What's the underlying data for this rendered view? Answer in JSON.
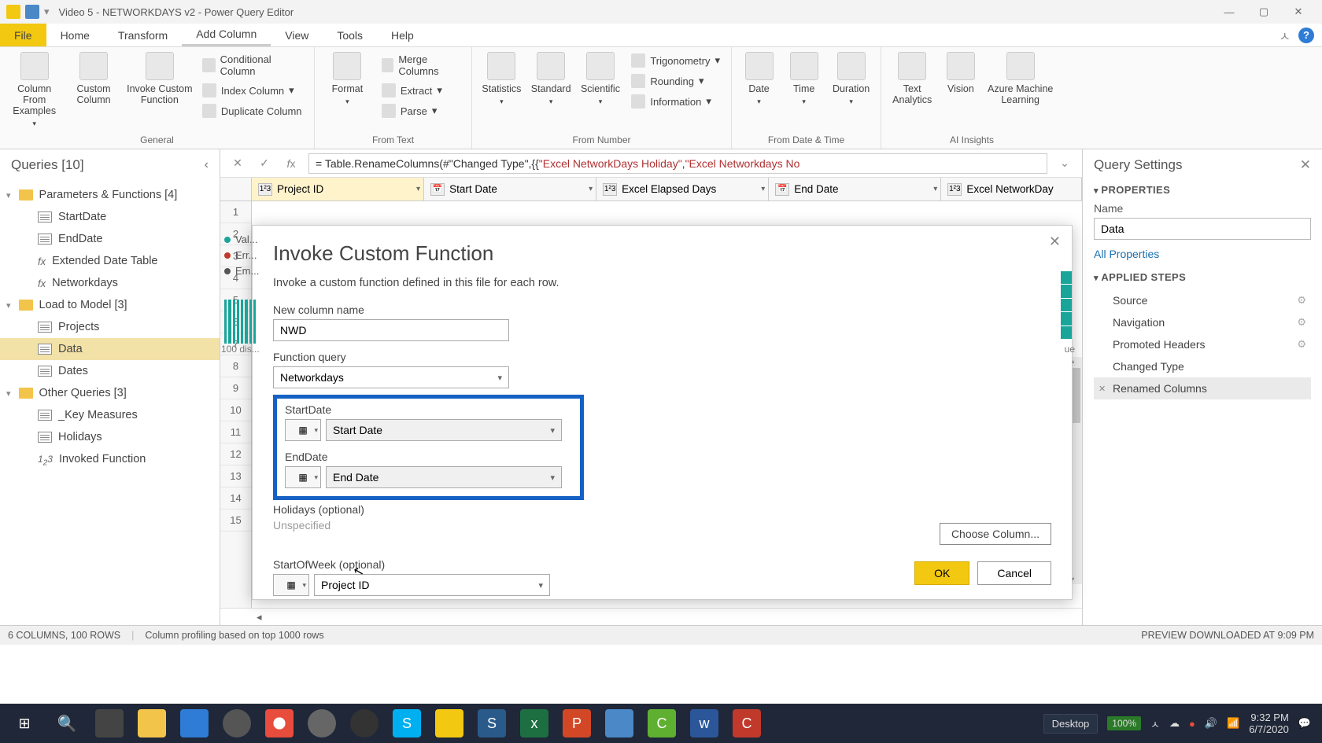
{
  "titlebar": {
    "title": "Video 5 - NETWORKDAYS v2 - Power Query Editor"
  },
  "tabs": {
    "file": "File",
    "home": "Home",
    "transform": "Transform",
    "add": "Add Column",
    "view": "View",
    "tools": "Tools",
    "help": "Help"
  },
  "ribbon": {
    "general": {
      "label": "General",
      "col_examples": "Column From Examples",
      "custom_col": "Custom Column",
      "invoke": "Invoke Custom Function",
      "conditional": "Conditional Column",
      "index": "Index Column",
      "duplicate": "Duplicate Column"
    },
    "fromtext": {
      "label": "From Text",
      "format": "Format",
      "merge": "Merge Columns",
      "extract": "Extract",
      "parse": "Parse"
    },
    "fromnumber": {
      "label": "From Number",
      "stats": "Statistics",
      "standard": "Standard",
      "scientific": "Scientific",
      "trig": "Trigonometry",
      "rounding": "Rounding",
      "info": "Information"
    },
    "datetime": {
      "label": "From Date & Time",
      "date": "Date",
      "time": "Time",
      "duration": "Duration"
    },
    "ai": {
      "label": "AI Insights",
      "text": "Text Analytics",
      "vision": "Vision",
      "azure": "Azure Machine Learning"
    }
  },
  "queries": {
    "header": "Queries [10]",
    "g1": "Parameters & Functions [4]",
    "g1_items": {
      "a": "StartDate",
      "b": "EndDate",
      "c": "Extended Date Table",
      "d": "Networkdays"
    },
    "g2": "Load to Model [3]",
    "g2_items": {
      "a": "Projects",
      "b": "Data",
      "c": "Dates"
    },
    "g3": "Other Queries [3]",
    "g3_items": {
      "a": "_Key Measures",
      "b": "Holidays",
      "c": "Invoked Function"
    }
  },
  "formula": {
    "prefix": "= Table.RenameColumns(#\"Changed Type\",{{",
    "lit1": "\"Excel NetworkDays  Holiday\"",
    "sep": ", ",
    "lit2": "\"Excel Networkdays No"
  },
  "columns": {
    "c1": "Project ID",
    "c2": "Start Date",
    "c3": "Excel Elapsed Days",
    "c4": "End Date",
    "c5": "Excel NetworkDay"
  },
  "stats": {
    "valid": "Val...",
    "error": "Err...",
    "empty": "Em...",
    "distinct": "100 dis...",
    "ue": "ue"
  },
  "dialog": {
    "title": "Invoke Custom Function",
    "desc": "Invoke a custom function defined in this file for each row.",
    "newcol_label": "New column name",
    "newcol_value": "NWD",
    "fq_label": "Function query",
    "fq_value": "Networkdays",
    "start_label": "StartDate",
    "start_value": "Start Date",
    "end_label": "EndDate",
    "end_value": "End Date",
    "holidays_label": "Holidays (optional)",
    "holidays_value": "Unspecified",
    "choose": "Choose Column...",
    "sow_label": "StartOfWeek (optional)",
    "sow_value": "Project ID",
    "ok": "OK",
    "cancel": "Cancel"
  },
  "settings": {
    "header": "Query Settings",
    "properties": "PROPERTIES",
    "name_label": "Name",
    "name_value": "Data",
    "allprops": "All Properties",
    "applied": "APPLIED STEPS",
    "steps": {
      "a": "Source",
      "b": "Navigation",
      "c": "Promoted Headers",
      "d": "Changed Type",
      "e": "Renamed Columns"
    }
  },
  "status": {
    "left1": "6 COLUMNS, 100 ROWS",
    "left2": "Column profiling based on top 1000 rows",
    "right": "PREVIEW DOWNLOADED AT 9:09 PM"
  },
  "taskbar": {
    "desktop": "Desktop",
    "battery": "100%",
    "time": "9:32 PM",
    "date": "6/7/2020"
  }
}
